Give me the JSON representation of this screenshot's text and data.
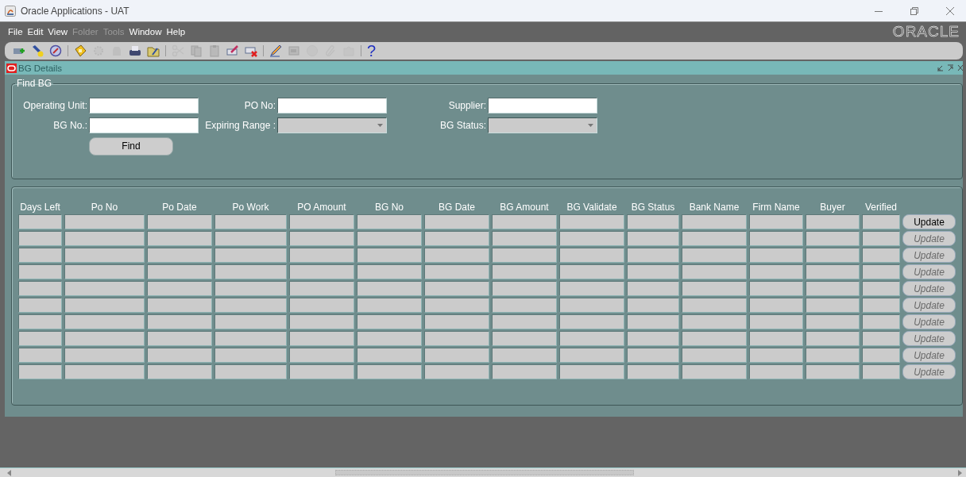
{
  "window": {
    "title": "Oracle Applications - UAT"
  },
  "menu": [
    {
      "label": "File",
      "disabled": false
    },
    {
      "label": "Edit",
      "disabled": false
    },
    {
      "label": "View",
      "disabled": false
    },
    {
      "label": "Folder",
      "disabled": true
    },
    {
      "label": "Tools",
      "disabled": true
    },
    {
      "label": "Window",
      "disabled": false
    },
    {
      "label": "Help",
      "disabled": false
    }
  ],
  "brand": {
    "logo_text": "ORACLE"
  },
  "toolbar": [
    {
      "kind": "icon",
      "disabled": false
    },
    {
      "kind": "icon",
      "disabled": false
    },
    {
      "kind": "icon",
      "disabled": false
    },
    {
      "kind": "separator"
    },
    {
      "kind": "icon",
      "disabled": false
    },
    {
      "kind": "icon",
      "disabled": true
    },
    {
      "kind": "icon",
      "disabled": true
    },
    {
      "kind": "icon",
      "disabled": false
    },
    {
      "kind": "icon",
      "disabled": false
    },
    {
      "kind": "separator"
    },
    {
      "kind": "icon",
      "disabled": true
    },
    {
      "kind": "icon",
      "disabled": true
    },
    {
      "kind": "icon",
      "disabled": true
    },
    {
      "kind": "icon",
      "disabled": false
    },
    {
      "kind": "icon",
      "disabled": false
    },
    {
      "kind": "separator"
    },
    {
      "kind": "icon",
      "disabled": false
    },
    {
      "kind": "icon",
      "disabled": true
    },
    {
      "kind": "icon",
      "disabled": true
    },
    {
      "kind": "icon",
      "disabled": true
    },
    {
      "kind": "icon",
      "disabled": true
    },
    {
      "kind": "separator"
    },
    {
      "kind": "text",
      "label": "?",
      "disabled": false
    }
  ],
  "form_window": {
    "title": "BG Details",
    "active": false
  },
  "find_section": {
    "title": "Find BG",
    "fields": [
      {
        "label": "Operating Unit:",
        "kind": "text"
      },
      {
        "label": "PO No:",
        "kind": "text"
      },
      {
        "label": "Supplier:",
        "kind": "text"
      },
      {
        "label": "BG No.:",
        "kind": "text"
      },
      {
        "label": "Expiring Range :",
        "kind": "dropdown"
      },
      {
        "label": "BG Status:",
        "kind": "dropdown"
      }
    ],
    "find_button": "Find"
  },
  "table": {
    "columns": [
      "Days Left",
      "Po No",
      "Po Date",
      "Po Work",
      "PO Amount",
      "BG No",
      "BG Date",
      "BG Amount",
      "BG Validate",
      "BG Status",
      "Bank Name",
      "Firm Name",
      "Buyer",
      "Verified"
    ],
    "rows": [
      {
        "update_button": {
          "label": "Update",
          "disabled": false
        }
      },
      {
        "update_button": {
          "label": "Update",
          "disabled": true
        }
      },
      {
        "update_button": {
          "label": "Update",
          "disabled": true
        }
      },
      {
        "update_button": {
          "label": "Update",
          "disabled": true
        }
      },
      {
        "update_button": {
          "label": "Update",
          "disabled": true
        }
      },
      {
        "update_button": {
          "label": "Update",
          "disabled": true
        }
      },
      {
        "update_button": {
          "label": "Update",
          "disabled": true
        }
      },
      {
        "update_button": {
          "label": "Update",
          "disabled": true
        }
      },
      {
        "update_button": {
          "label": "Update",
          "disabled": true
        }
      },
      {
        "update_button": {
          "label": "Update",
          "disabled": true
        }
      }
    ]
  }
}
